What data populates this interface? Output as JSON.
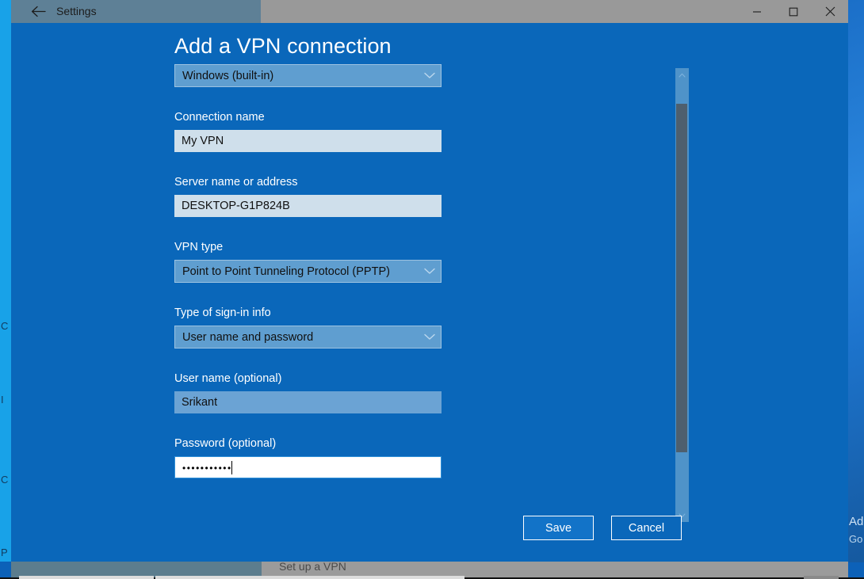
{
  "window": {
    "titlebar": {
      "back_icon": "back-arrow-icon",
      "title": "Settings",
      "minimize_label": "minimize-icon",
      "maximize_label": "maximize-icon",
      "close_label": "close-icon"
    }
  },
  "dialog": {
    "page_title": "Add a VPN connection",
    "fields": {
      "provider": {
        "label": "",
        "value": "Windows (built-in)",
        "type": "combobox",
        "chevron": "chevron-down-icon"
      },
      "connection_name": {
        "label": "Connection name",
        "value": "My VPN",
        "placeholder": "",
        "type": "textbox"
      },
      "server_name": {
        "label": "Server name or address",
        "value": "DESKTOP-G1P824B",
        "placeholder": "",
        "type": "textbox"
      },
      "vpn_type": {
        "label": "VPN type",
        "value": "Point to Point Tunneling Protocol (PPTP)",
        "type": "combobox",
        "chevron": "chevron-down-icon"
      },
      "signin_type": {
        "label": "Type of sign-in info",
        "value": "User name and password",
        "type": "combobox",
        "chevron": "chevron-down-icon"
      },
      "user_name": {
        "label": "User name (optional)",
        "value": "Srikant",
        "placeholder": "",
        "type": "textbox"
      },
      "password": {
        "label": "Password (optional)",
        "value": "•••••••••••",
        "masked_char_count": 11,
        "placeholder": "",
        "type": "password",
        "focused": true
      }
    },
    "buttons": {
      "save": "Save",
      "cancel": "Cancel"
    },
    "scrollbar": {
      "up_icon": "chevron-up-icon",
      "down_icon": "chevron-down-icon"
    }
  },
  "background": {
    "bottom_label": "Set up a VPN",
    "right_line_1": "Ad",
    "right_line_2": "Go",
    "left_fragments": [
      "C",
      "I",
      "C",
      "P"
    ]
  },
  "colors": {
    "dialog_blue": "#0a67ba",
    "titlebar_gray": "#999999",
    "titlebar_left": "#5e8096",
    "combo_fill": "#5f9ed0",
    "textfield_fill": "#cfdfeb",
    "textfield_shaded": "#6ba3d4",
    "accent_strip": "#18a2e8",
    "scrollbar_track": "#4f93c9",
    "scrollbar_thumb": "#4e5f6e"
  }
}
